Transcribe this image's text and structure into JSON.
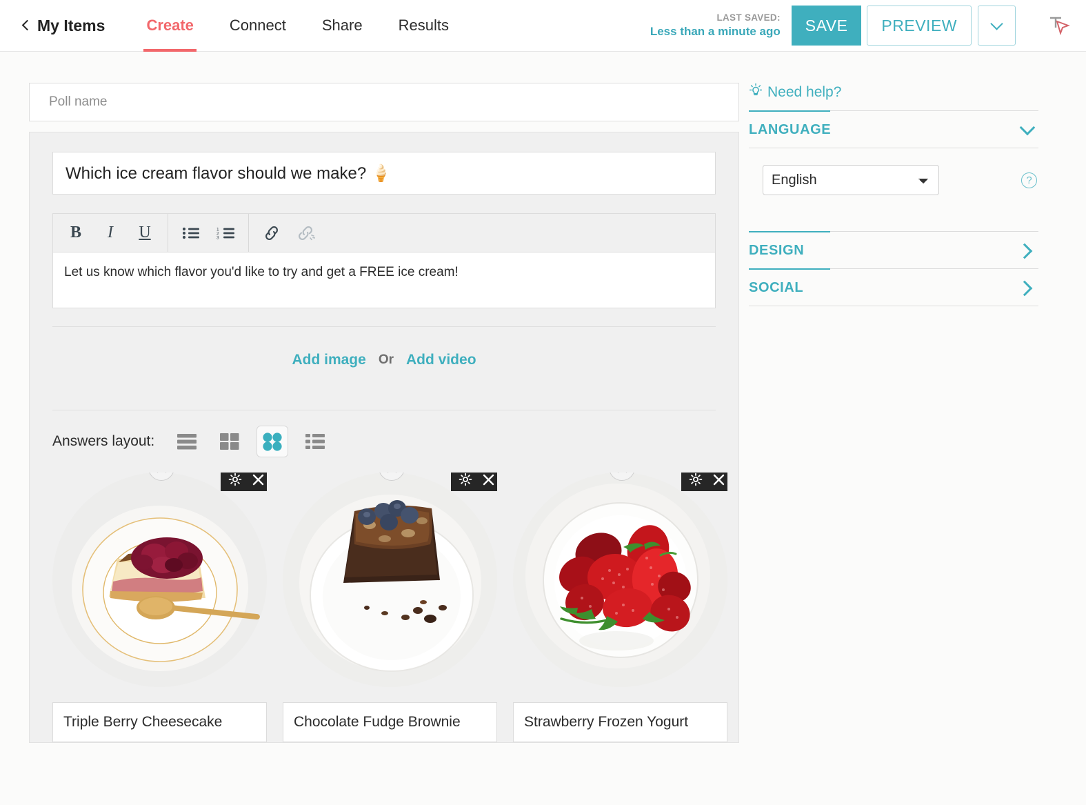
{
  "topbar": {
    "back_label": "My Items",
    "tabs": [
      {
        "label": "Create",
        "active": true
      },
      {
        "label": "Connect",
        "active": false
      },
      {
        "label": "Share",
        "active": false
      },
      {
        "label": "Results",
        "active": false
      }
    ],
    "last_saved_label": "LAST SAVED:",
    "last_saved_value": "Less than a minute ago",
    "save_label": "SAVE",
    "preview_label": "PREVIEW",
    "accent_teal": "#3fafbe",
    "accent_coral": "#f2676b"
  },
  "form": {
    "poll_name_placeholder": "Poll name",
    "poll_name_value": "",
    "question_value": "Which ice cream flavor should we make? 🍦",
    "description_value": "Let us know which flavor you'd like to try and get a FREE ice cream!",
    "editor_tools": [
      {
        "name": "bold",
        "label": "B"
      },
      {
        "name": "italic",
        "label": "I"
      },
      {
        "name": "underline",
        "label": "U"
      },
      {
        "name": "bullet-list",
        "label": ""
      },
      {
        "name": "numbered-list",
        "label": ""
      },
      {
        "name": "link",
        "label": ""
      },
      {
        "name": "unlink",
        "label": ""
      }
    ],
    "add_image_label": "Add image",
    "or_label": "Or",
    "add_video_label": "Add video",
    "answers_layout_label": "Answers layout:",
    "layout_options": [
      {
        "name": "stacked-bars",
        "selected": false
      },
      {
        "name": "grid-squares",
        "selected": false
      },
      {
        "name": "grid-circles",
        "selected": true
      },
      {
        "name": "list",
        "selected": false
      }
    ],
    "answers": [
      {
        "label": "Triple Berry Cheesecake",
        "image_alt": "cheesecake-slice-with-berry-compote-on-gold-rimmed-plate"
      },
      {
        "label": "Chocolate Fudge Brownie",
        "image_alt": "chocolate-fudge-brownie-square-with-blueberries-on-white-plate"
      },
      {
        "label": "Strawberry Frozen Yogurt",
        "image_alt": "bowl-of-fresh-strawberries"
      }
    ]
  },
  "sidebar": {
    "need_help_label": "Need help?",
    "sections": [
      {
        "title": "LANGUAGE",
        "expanded": true
      },
      {
        "title": "DESIGN",
        "expanded": false
      },
      {
        "title": "SOCIAL",
        "expanded": false
      }
    ],
    "language_value": "English",
    "language_options": [
      "English"
    ]
  }
}
